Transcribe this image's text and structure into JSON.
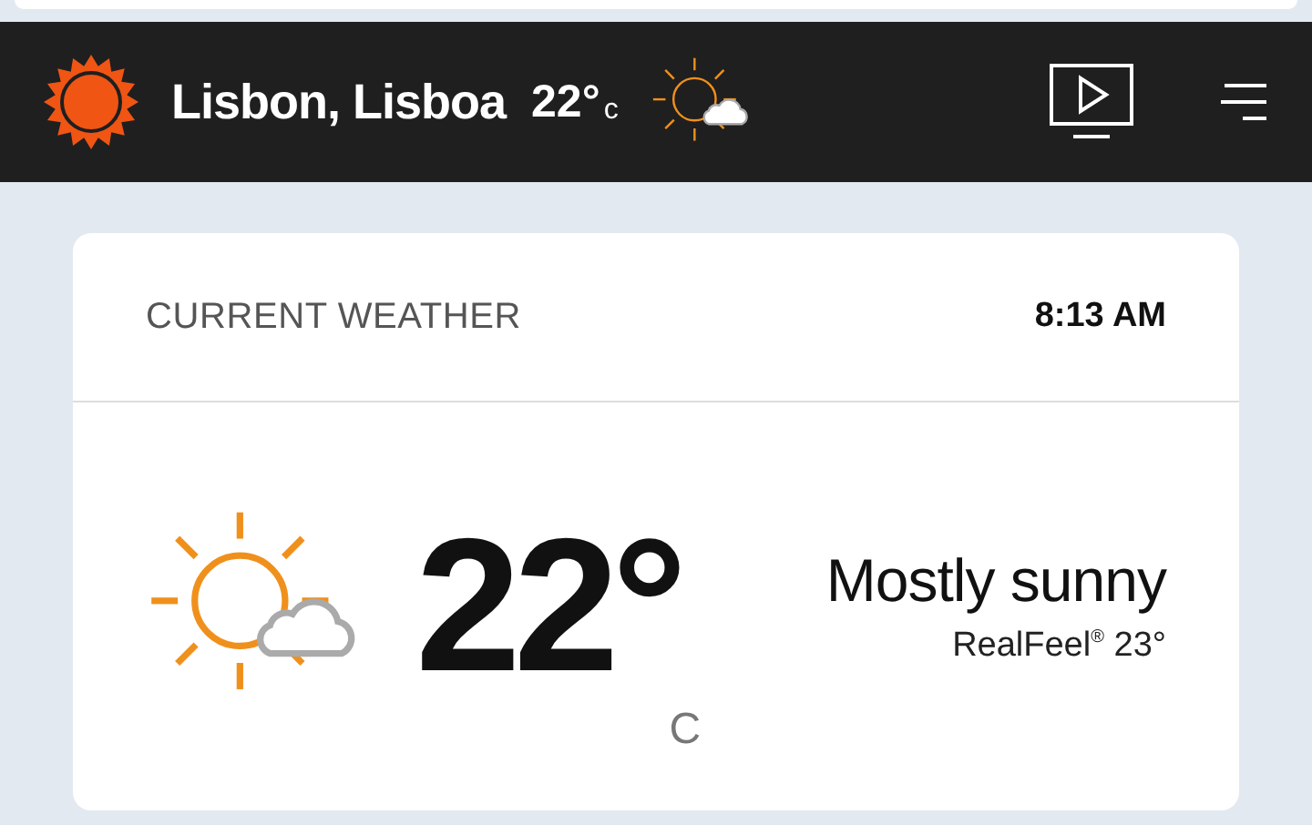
{
  "header": {
    "city": "Lisbon, Lisboa",
    "temperature": "22°",
    "unit": "c"
  },
  "card": {
    "title": "CURRENT WEATHER",
    "time": "8:13 AM",
    "temperature": "22°",
    "unit": "C",
    "condition": "Mostly sunny",
    "realfeel": "RealFeel$^{®}$ 23°"
  }
}
